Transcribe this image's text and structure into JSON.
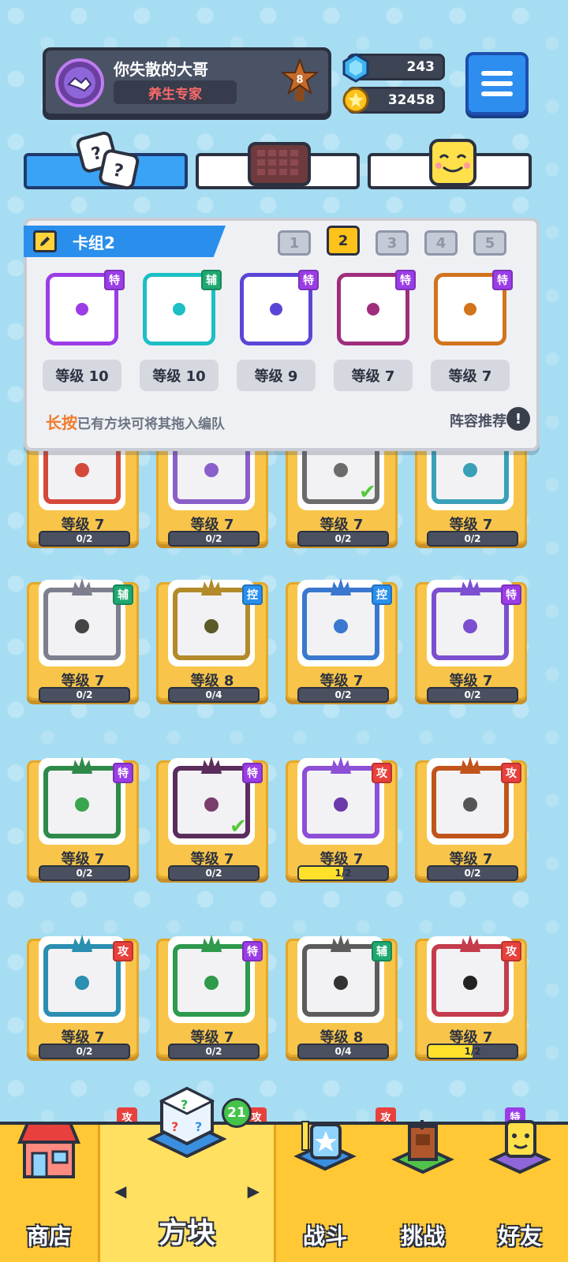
{
  "player": {
    "name": "你失散的大哥",
    "title": "养生专家",
    "rank": "8"
  },
  "currency": {
    "gems": "243",
    "coins": "32458"
  },
  "icons": {
    "menu": "menu-icon",
    "gem": "gem-icon",
    "coin": "coin-icon",
    "tab1": "dice-icon",
    "tab2": "chocolate-board-icon",
    "tab3": "smiley-block-icon"
  },
  "deck": {
    "title": "卡组2",
    "slots": [
      "1",
      "2",
      "3",
      "4",
      "5"
    ],
    "active_slot": 2,
    "cards": [
      {
        "tag": "特",
        "type": "special",
        "level": "等级 10",
        "border": "#9b3de6"
      },
      {
        "tag": "辅",
        "type": "support",
        "level": "等级 10",
        "border": "#1bbfc4"
      },
      {
        "tag": "特",
        "type": "special",
        "level": "等级 9",
        "border": "#5a46d6"
      },
      {
        "tag": "特",
        "type": "special",
        "level": "等级 7",
        "border": "#a02c7c"
      },
      {
        "tag": "特",
        "type": "special",
        "level": "等级 7",
        "border": "#d1741c"
      }
    ],
    "hint_long": "长按",
    "hint_rest": "已有方块可将其拖入编队",
    "recommend": "阵容推荐",
    "recommend_icon": "!"
  },
  "grid": {
    "partial_row": [
      {
        "level": "等级 7",
        "progress": "0/2",
        "fill": 0,
        "border": "#d44a3a"
      },
      {
        "level": "等级 7",
        "progress": "0/2",
        "fill": 0,
        "border": "#8a5fc9"
      },
      {
        "level": "等级 7",
        "progress": "0/2",
        "fill": 0,
        "border": "#6b6b6b",
        "checked": true
      },
      {
        "level": "等级 7",
        "progress": "0/2",
        "fill": 0,
        "border": "#3aa0b8"
      }
    ],
    "rows": [
      [
        {
          "tag": "辅",
          "type": "support",
          "level": "等级 7",
          "progress": "0/2",
          "fill": 0,
          "border": "#7d7f8e",
          "dot": "#444"
        },
        {
          "tag": "控",
          "type": "control",
          "level": "等级 8",
          "progress": "0/4",
          "fill": 0,
          "border": "#b38a2a",
          "dot": "#5a5a2a"
        },
        {
          "tag": "控",
          "type": "control",
          "level": "等级 7",
          "progress": "0/2",
          "fill": 0,
          "border": "#3a78d0",
          "dot": "#3a78d0"
        },
        {
          "tag": "特",
          "type": "special",
          "level": "等级 7",
          "progress": "0/2",
          "fill": 0,
          "border": "#7b4fd0",
          "dot": "#7b4fd0"
        }
      ],
      [
        {
          "tag": "特",
          "type": "special",
          "level": "等级 7",
          "progress": "0/2",
          "fill": 0,
          "border": "#2f8a4a",
          "dot": "#3aa54f"
        },
        {
          "tag": "特",
          "type": "special",
          "level": "等级 7",
          "progress": "0/2",
          "fill": 0,
          "border": "#5a2d5c",
          "dot": "#7a3d6c",
          "checked": true
        },
        {
          "tag": "攻",
          "type": "attack",
          "level": "等级 7",
          "progress": "1/2",
          "fill": 0.5,
          "border": "#8c4fd6",
          "dot": "#6a3aa8"
        },
        {
          "tag": "攻",
          "type": "attack",
          "level": "等级 7",
          "progress": "0/2",
          "fill": 0,
          "border": "#c0541c",
          "dot": "#555"
        }
      ],
      [
        {
          "tag": "攻",
          "type": "attack",
          "level": "等级 7",
          "progress": "0/2",
          "fill": 0,
          "border": "#2a8fb0",
          "dot": "#2a8fb0"
        },
        {
          "tag": "特",
          "type": "special",
          "level": "等级 7",
          "progress": "0/2",
          "fill": 0,
          "border": "#2e9a4c",
          "dot": "#2e9a4c"
        },
        {
          "tag": "辅",
          "type": "support",
          "level": "等级 8",
          "progress": "0/4",
          "fill": 0,
          "border": "#5c5c5c",
          "dot": "#333"
        },
        {
          "tag": "攻",
          "type": "attack",
          "level": "等级 7",
          "progress": "1/2",
          "fill": 0.5,
          "border": "#c43c4c",
          "dot": "#222"
        }
      ]
    ],
    "peek_tags": [
      "攻",
      "攻",
      "攻",
      "特"
    ]
  },
  "nav": {
    "items": [
      {
        "label": "商店",
        "icon": "shop-icon"
      },
      {
        "label": "方块",
        "icon": "mystery-block-icon",
        "badge": "21"
      },
      {
        "label": "战斗",
        "icon": "battle-icon"
      },
      {
        "label": "挑战",
        "icon": "challenge-icon"
      },
      {
        "label": "好友",
        "icon": "friends-icon"
      }
    ],
    "arrow_left": "◀",
    "arrow_right": "▶"
  }
}
